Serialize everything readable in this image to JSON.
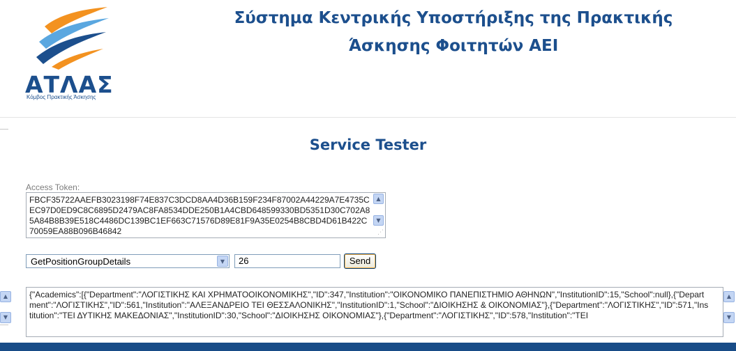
{
  "logo": {
    "wordmark": "ΑΤΛΑΣ",
    "tagline": "Κόμβος Πρακτικής Άσκησης",
    "colors": {
      "blue": "#1c4f8d",
      "orange": "#f39220",
      "lightblue": "#5aa7e0"
    }
  },
  "header": {
    "title_line1": "Σύστημα Κεντρικής Υποστήριξης της Πρακτικής",
    "title_line2": "Άσκησης Φοιτητών ΑΕΙ"
  },
  "page": {
    "title": "Service Tester"
  },
  "form": {
    "token_label": "Access Token:",
    "token_value": "FBCF35722AAEFB3023198F74E837C3DCD8AA4D36B159F234F87002A44229A7E4735CEC97D0ED9C8C6895D2479AC8FA8534DDE250B1A4CBD648599330BD5351D30C702A85A84B8B39E518C4486DC139BC1EF663C71576D89E81F9A35E0254B8CBD4D61B422C70059EA88B096B46842",
    "method_selected": "GetPositionGroupDetails",
    "id_value": "26",
    "send_label": "Send"
  },
  "result": {
    "text": "{\"Academics\":[{\"Department\":\"ΛΟΓΙΣΤΙΚΗΣ ΚΑΙ ΧΡΗΜΑΤΟΟΙΚΟΝΟΜΙΚΗΣ\",\"ID\":347,\"Institution\":\"ΟΙΚΟΝΟΜΙΚΟ ΠΑΝΕΠΙΣΤΗΜΙΟ ΑΘΗΝΩΝ\",\"InstitutionID\":15,\"School\":null},{\"Department\":\"ΛΟΓΙΣΤΙΚΗΣ\",\"ID\":561,\"Institution\":\"ΑΛΕΞΑΝΔΡΕΙΟ ΤΕΙ ΘΕΣΣΑΛΟΝΙΚΗΣ\",\"InstitutionID\":1,\"School\":\"ΔΙΟΙΚΗΣΗΣ & ΟΙΚΟΝΟΜΙΑΣ\"},{\"Department\":\"ΛΟΓΙΣΤΙΚΗΣ\",\"ID\":571,\"Institution\":\"ΤΕΙ ΔΥΤΙΚΗΣ ΜΑΚΕΔΟΝΙΑΣ\",\"InstitutionID\":30,\"School\":\"ΔΙΟΙΚΗΣΗΣ ΟΙΚΟΝΟΜΙΑΣ\"},{\"Department\":\"ΛΟΓΙΣΤΙΚΗΣ\",\"ID\":578,\"Institution\":\"ΤΕΙ"
  },
  "theme": {
    "accent": "#1c4f8d",
    "footer_band": "#184c87"
  }
}
